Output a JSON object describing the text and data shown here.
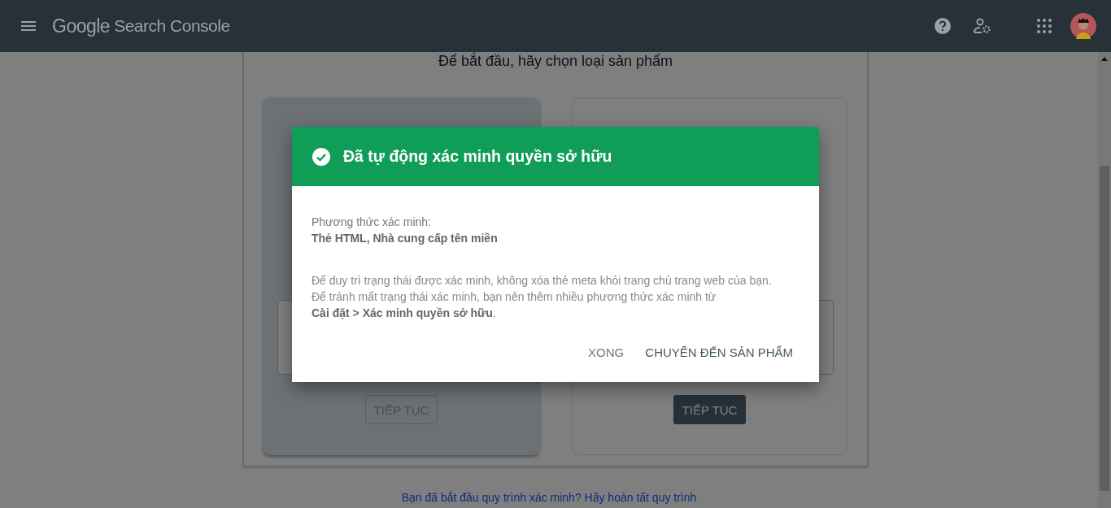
{
  "header": {
    "brand": "Google",
    "product": "Search Console"
  },
  "page": {
    "heading": "Để bắt đầu, hãy chọn loại sản phẩm",
    "cards": [
      {
        "selected": true,
        "button": "TIẾP TỤC"
      },
      {
        "selected": false,
        "button": "TIẾP TỤC"
      }
    ],
    "footer_link": "Bạn đã bắt đầu quy trình xác minh? Hãy hoàn tất quy trình"
  },
  "dialog": {
    "title": "Đã tự động xác minh quyền sở hữu",
    "method_label": "Phương thức xác minh:",
    "method_value": "Thẻ HTML, Nhà cung cấp tên miền",
    "note_lines": [
      "Để duy trì trạng thái được xác minh, không xóa thẻ meta khỏi trang chủ trang web của bạn.",
      "Để tránh mất trạng thái xác minh, bạn nên thêm nhiều phương thức xác minh từ",
      "**Cài đặt > Xác minh quyền sở hữu**."
    ],
    "buttons": [
      {
        "label": "XONG",
        "kind": "text"
      },
      {
        "label": "CHUYỂN ĐẾN SẢN PHẨM",
        "kind": "primary"
      }
    ]
  }
}
